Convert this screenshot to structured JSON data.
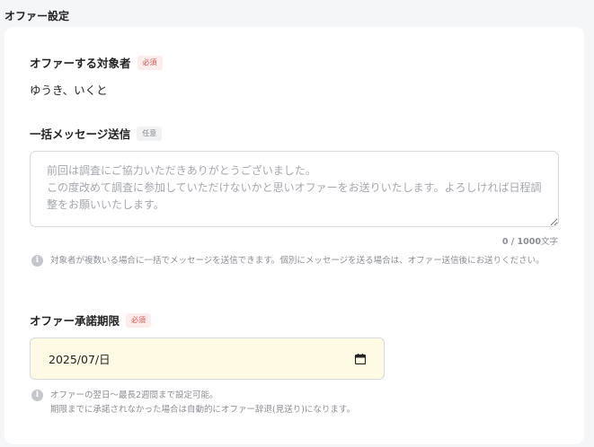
{
  "section": {
    "title": "オファー設定"
  },
  "target": {
    "label": "オファーする対象者",
    "badge": "必須",
    "value": "ゆうき、いくと"
  },
  "message": {
    "label": "一括メッセージ送信",
    "badge": "任意",
    "placeholder": "前回は調査にご協力いただきありがとうございました。\nこの度改めて調査に参加していただけないかと思いオファーをお送りいたします。よろしければ日程調整をお願いいたします。",
    "value": "",
    "count": "0 / 1000",
    "count_unit": "文字",
    "note": "対象者が複数いる場合に一括でメッセージを送信できます。個別にメッセージを送る場合は、オファー送信後にお送りください。"
  },
  "deadline": {
    "label": "オファー承諾期限",
    "badge": "必須",
    "value": "2025/07/日",
    "note_line1": "オファーの翌日〜最長2週間まで設定可能。",
    "note_line2": "期限までに承諾されなかった場合は自動的にオファー辞退(見送り)になります。"
  },
  "icons": {
    "info": "info-icon",
    "calendar": "calendar-icon"
  },
  "colors": {
    "required_badge_bg": "#fdecec",
    "required_badge_text": "#d9534f",
    "date_input_bg": "#fefae3"
  }
}
